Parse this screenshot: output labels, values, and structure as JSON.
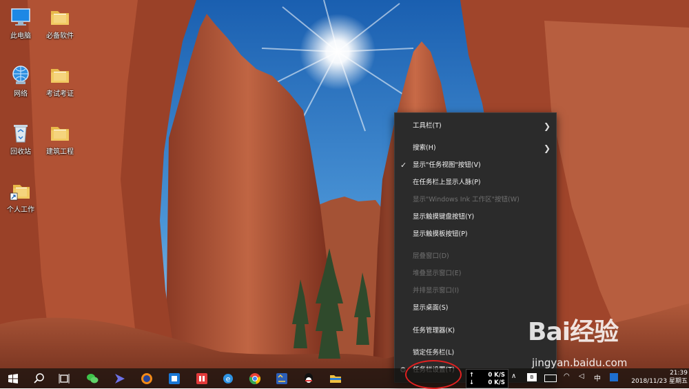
{
  "desktop": {
    "icons": [
      {
        "label": "此电脑",
        "icon": "computer-icon"
      },
      {
        "label": "必备软件",
        "icon": "folder-icon"
      },
      {
        "label": "网络",
        "icon": "network-icon"
      },
      {
        "label": "考试考证",
        "icon": "folder-icon"
      },
      {
        "label": "回收站",
        "icon": "recycle-bin-icon"
      },
      {
        "label": "建筑工程",
        "icon": "folder-icon"
      },
      {
        "label": "个人工作",
        "icon": "folder-shortcut-icon"
      }
    ]
  },
  "context_menu": {
    "items": [
      {
        "label": "工具栏(T)",
        "enabled": true,
        "submenu": true
      },
      {
        "label": "搜索(H)",
        "enabled": true,
        "submenu": true
      },
      {
        "label": "显示\"任务视图\"按钮(V)",
        "enabled": true,
        "checked": true
      },
      {
        "label": "在任务栏上显示人脉(P)",
        "enabled": true
      },
      {
        "label": "显示\"Windows Ink 工作区\"按钮(W)",
        "enabled": false
      },
      {
        "label": "显示触摸键盘按钮(Y)",
        "enabled": true
      },
      {
        "label": "显示触摸板按钮(P)",
        "enabled": true
      },
      {
        "label": "层叠窗口(D)",
        "enabled": false
      },
      {
        "label": "堆叠显示窗口(E)",
        "enabled": false
      },
      {
        "label": "并排显示窗口(I)",
        "enabled": false
      },
      {
        "label": "显示桌面(S)",
        "enabled": true
      },
      {
        "label": "任务管理器(K)",
        "enabled": true
      },
      {
        "label": "锁定任务栏(L)",
        "enabled": true
      },
      {
        "label": "任务栏设置(T)",
        "enabled": true,
        "icon": "gear-icon"
      }
    ]
  },
  "taskbar": {
    "pinned": [
      "start-icon",
      "search-icon",
      "task-view-icon",
      "wechat-icon",
      "app-icon",
      "firefox-icon",
      "app-store-icon",
      "netease-icon",
      "ie-icon",
      "chrome-icon",
      "app-icon",
      "qq-icon",
      "file-explorer-icon"
    ],
    "net_speed": {
      "up": "0 K/S",
      "down": "0 K/S"
    },
    "ime": "中",
    "clock": {
      "time": "21:39",
      "date": "2018/11/23 星期五"
    }
  },
  "watermark": {
    "brand": "Bai经验",
    "url": "jingyan.baidu.com"
  },
  "colors": {
    "menu_bg": "#2b2b2b",
    "highlight": "#e02020",
    "taskbar": "#12100e"
  }
}
